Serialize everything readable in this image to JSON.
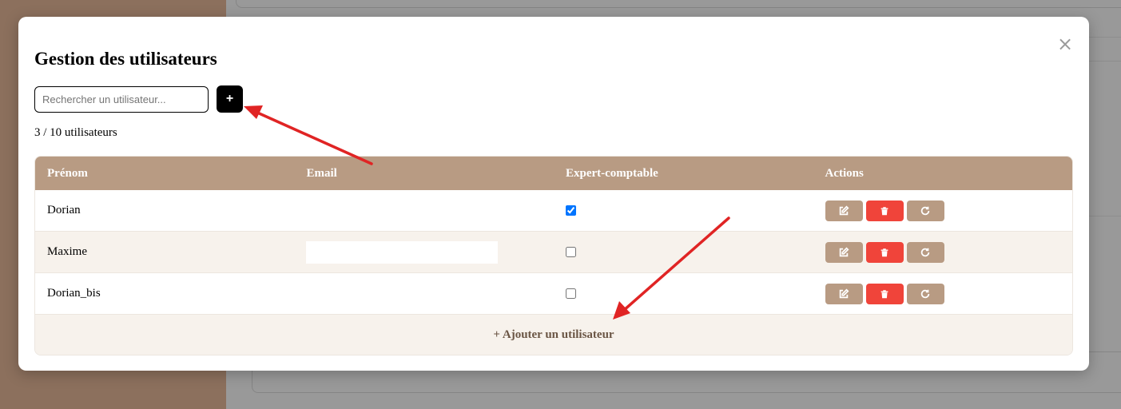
{
  "modal": {
    "title": "Gestion des utilisateurs",
    "close_label": "×",
    "search_placeholder": "Rechercher un utilisateur...",
    "add_button_label": "+",
    "user_count": "3 / 10 utilisateurs"
  },
  "table": {
    "headers": [
      "Prénom",
      "Email",
      "Expert-comptable",
      "Actions"
    ],
    "rows": [
      {
        "first_name": "Dorian",
        "email": "",
        "expert_comptable": true
      },
      {
        "first_name": "Maxime",
        "email": "",
        "expert_comptable": false
      },
      {
        "first_name": "Dorian_bis",
        "email": "",
        "expert_comptable": false
      }
    ],
    "add_row_label": "+ Ajouter un utilisateur",
    "action_icons": [
      "edit-icon",
      "trash-icon",
      "refresh-icon"
    ]
  },
  "colors": {
    "accent": "#b89b83",
    "danger": "#f0443a",
    "annotation_arrow": "#e02424"
  }
}
